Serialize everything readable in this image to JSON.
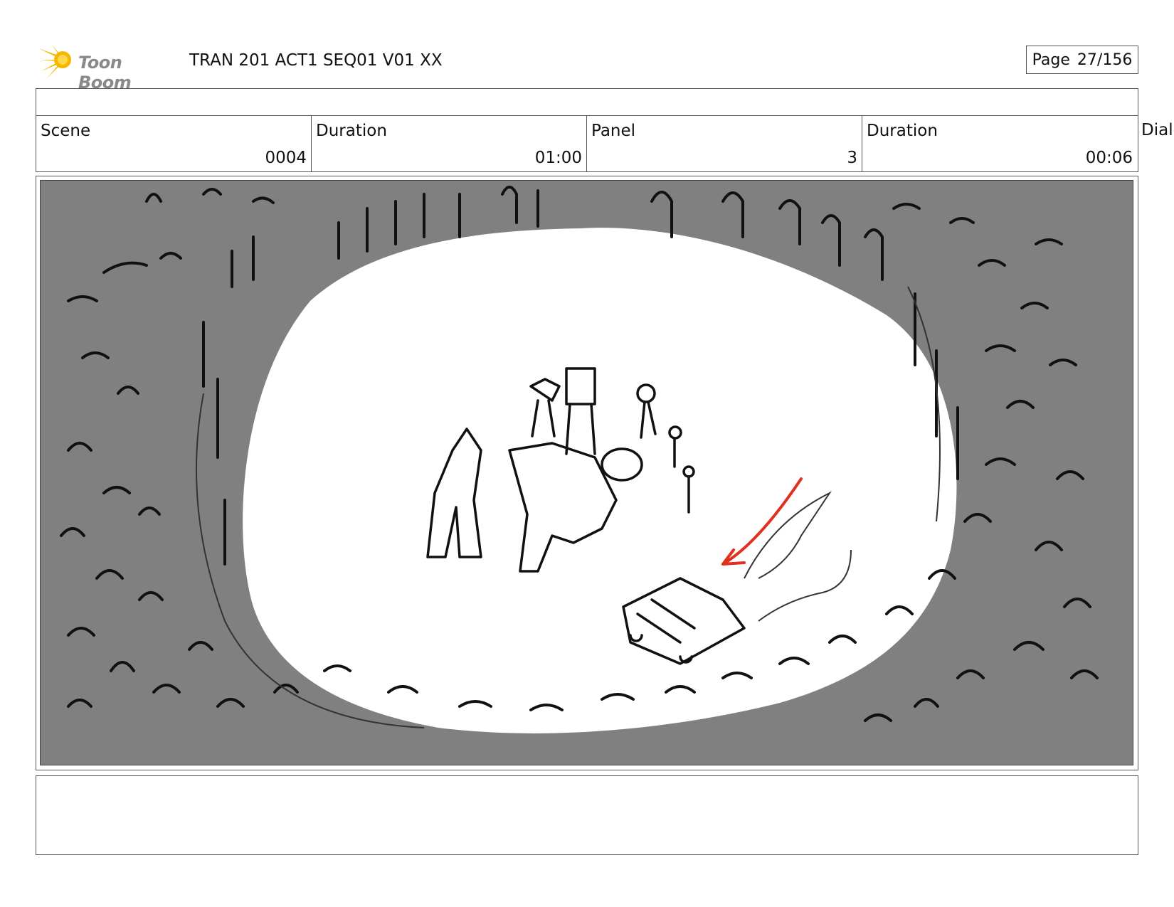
{
  "header": {
    "logo_text": "Toon Boom",
    "title": "TRAN 201 ACT1 SEQ01 V01 XX",
    "page_label": "Page",
    "page_value": "27/156"
  },
  "info": {
    "scene_label": "Scene",
    "scene_value": "0004",
    "scene_duration_label": "Duration",
    "scene_duration_value": "01:00",
    "panel_label": "Panel",
    "panel_value": "3",
    "panel_duration_label": "Duration",
    "panel_duration_value": "00:06",
    "dialog_label": "Dialog"
  },
  "panel_image": {
    "icon": "storyboard-sketch",
    "colors": {
      "crowd": "#808080",
      "arena": "#ffffff",
      "ink": "#111111",
      "arrow": "#e0301e"
    }
  },
  "notes": {
    "text": ""
  },
  "colors": {
    "logo_flare": "#f5b800",
    "logo_text": "#8a8a8a",
    "border": "#555555"
  }
}
